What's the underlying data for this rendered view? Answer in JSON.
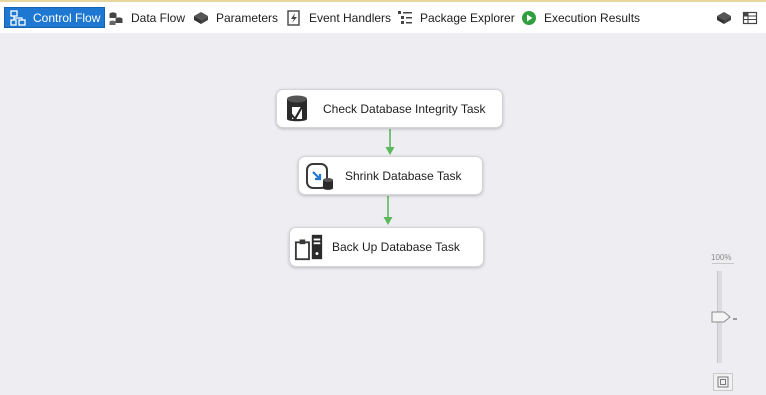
{
  "toolbar": {
    "tabs": [
      {
        "label": "Control Flow",
        "icon": "control-flow-icon",
        "active": true
      },
      {
        "label": "Data Flow",
        "icon": "data-flow-icon",
        "active": false
      },
      {
        "label": "Parameters",
        "icon": "parameters-icon",
        "active": false
      },
      {
        "label": "Event Handlers",
        "icon": "event-handlers-icon",
        "active": false
      },
      {
        "label": "Package Explorer",
        "icon": "package-explorer-icon",
        "active": false
      },
      {
        "label": "Execution Results",
        "icon": "execution-results-icon",
        "active": false
      }
    ],
    "right_icons": [
      "package-icon",
      "variables-grid-icon"
    ]
  },
  "canvas": {
    "tasks": [
      {
        "label": "Check Database Integrity Task",
        "icon": "database-check-icon"
      },
      {
        "label": "Shrink Database Task",
        "icon": "database-shrink-icon"
      },
      {
        "label": "Back Up Database Task",
        "icon": "database-backup-icon"
      }
    ],
    "precedence_constraint_color": "#5cb85c"
  },
  "zoom": {
    "label": "100%",
    "level": 1.0
  },
  "colors": {
    "accent": "#1e78d2",
    "canvas": "#eeeef2",
    "success": "#5cb85c"
  }
}
